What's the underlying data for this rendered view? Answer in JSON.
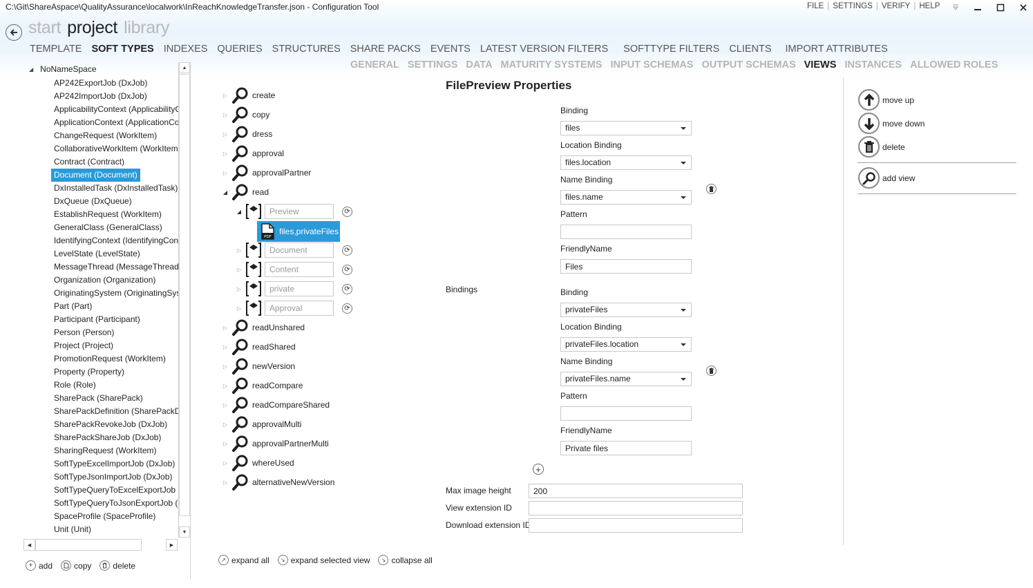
{
  "window": {
    "title": "C:\\Git\\ShareAspace\\QualityAssurance\\localwork\\InReachKnowledgeTransfer.json - Configuration Tool",
    "menu": [
      "FILE",
      "SETTINGS",
      "VERIFY",
      "HELP"
    ],
    "controls": {
      "minimize": "–",
      "maximize": "□",
      "close": "✕"
    }
  },
  "nav": {
    "items": [
      {
        "label": "start",
        "active": false
      },
      {
        "label": "project",
        "active": true
      },
      {
        "label": "library",
        "active": false
      }
    ]
  },
  "main_tabs": [
    {
      "label": "TEMPLATE",
      "active": false
    },
    {
      "label": "SOFT TYPES",
      "active": true
    },
    {
      "label": "INDEXES",
      "active": false
    },
    {
      "label": "QUERIES",
      "active": false
    },
    {
      "label": "STRUCTURES",
      "active": false
    },
    {
      "label": "SHARE PACKS",
      "active": false
    },
    {
      "label": "EVENTS",
      "active": false
    },
    {
      "label": "LATEST VERSION FILTERS",
      "active": false
    },
    {
      "label": "SOFTTYPE FILTERS",
      "active": false
    },
    {
      "label": "CLIENTS",
      "active": false
    },
    {
      "label": "IMPORT ATTRIBUTES",
      "active": false
    }
  ],
  "sub_tabs": [
    {
      "label": "GENERAL",
      "active": false
    },
    {
      "label": "SETTINGS",
      "active": false
    },
    {
      "label": "DATA",
      "active": false
    },
    {
      "label": "MATURITY SYSTEMS",
      "active": false
    },
    {
      "label": "INPUT SCHEMAS",
      "active": false
    },
    {
      "label": "OUTPUT SCHEMAS",
      "active": false
    },
    {
      "label": "VIEWS",
      "active": true
    },
    {
      "label": "INSTANCES",
      "active": false
    },
    {
      "label": "ALLOWED ROLES",
      "active": false
    }
  ],
  "soft_types": {
    "root": "NoNameSpace",
    "selected_index": 7,
    "items": [
      "AP242ExportJob (DxJob)",
      "AP242ImportJob (DxJob)",
      "ApplicabilityContext (ApplicabilityContext)",
      "ApplicationContext (ApplicationContext)",
      "ChangeRequest (WorkItem)",
      "CollaborativeWorkItem (WorkItem)",
      "Contract (Contract)",
      "Document (Document)",
      "DxInstalledTask (DxInstalledTask)",
      "DxQueue (DxQueue)",
      "EstablishRequest (WorkItem)",
      "GeneralClass (GeneralClass)",
      "IdentifyingContext (IdentifyingContext)",
      "LevelState (LevelState)",
      "MessageThread (MessageThread)",
      "Organization (Organization)",
      "OriginatingSystem (OriginatingSystem)",
      "Part (Part)",
      "Participant (Participant)",
      "Person (Person)",
      "Project (Project)",
      "PromotionRequest (WorkItem)",
      "Property (Property)",
      "Role (Role)",
      "SharePack (SharePack)",
      "SharePackDefinition (SharePackDefinition)",
      "SharePackRevokeJob (DxJob)",
      "SharePackShareJob (DxJob)",
      "SharingRequest (WorkItem)",
      "SoftTypeExcelImportJob (DxJob)",
      "SoftTypeJsonImportJob (DxJob)",
      "SoftTypeQueryToExcelExportJob (DxJob)",
      "SoftTypeQueryToJsonExportJob (DxJob)",
      "SpaceProfile (SpaceProfile)",
      "Unit (Unit)"
    ],
    "actions": {
      "add": "add",
      "copy": "copy",
      "delete": "delete"
    }
  },
  "views_tree": {
    "views_before": [
      "create",
      "copy",
      "dress",
      "approval",
      "approvalPartner"
    ],
    "expanded_view": "read",
    "sections": [
      {
        "placeholder": "Preview",
        "expanded": true
      },
      {
        "placeholder": "Document",
        "expanded": false
      },
      {
        "placeholder": "Content",
        "expanded": false
      },
      {
        "placeholder": "private",
        "expanded": false
      },
      {
        "placeholder": "Approval",
        "expanded": false
      }
    ],
    "selected_node": "files,privateFiles",
    "views_after": [
      "readUnshared",
      "readShared",
      "newVersion",
      "readCompare",
      "readCompareShared",
      "approvalMulti",
      "approvalPartnerMulti",
      "whereUsed",
      "alternativeNewVersion"
    ],
    "actions": {
      "expand_all": "expand all",
      "expand_selected": "expand selected view",
      "collapse_all": "collapse all"
    }
  },
  "properties": {
    "title": "FilePreview Properties",
    "bindings_label": "Bindings",
    "labels": {
      "binding": "Binding",
      "location_binding": "Location Binding",
      "name_binding": "Name Binding",
      "pattern": "Pattern",
      "friendly_name": "FriendlyName"
    },
    "bindings": [
      {
        "binding": "files",
        "location_binding": "files.location",
        "name_binding": "files.name",
        "pattern": "",
        "friendly_name": "Files"
      },
      {
        "binding": "privateFiles",
        "location_binding": "privateFiles.location",
        "name_binding": "privateFiles.name",
        "pattern": "",
        "friendly_name": "Private files"
      }
    ],
    "max_image_height_label": "Max image height",
    "max_image_height": "200",
    "view_extension_id_label": "View extension ID",
    "view_extension_id": "",
    "download_extension_id_label": "Download extension ID",
    "download_extension_id": ""
  },
  "right_actions": {
    "move_up": "move up",
    "move_down": "move down",
    "delete": "delete",
    "add_view": "add view"
  }
}
